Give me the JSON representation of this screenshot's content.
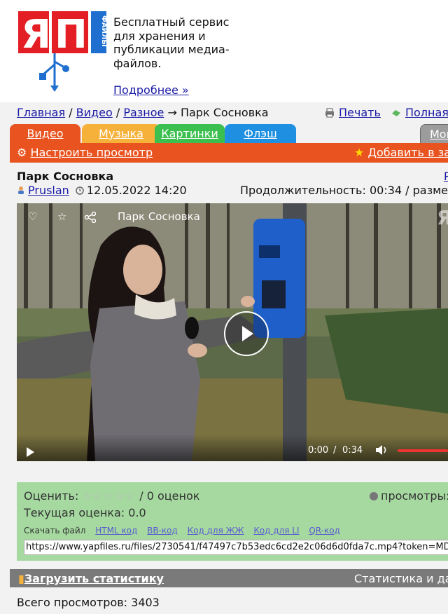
{
  "header": {
    "tagline": "Бесплатный сервис для хранения и публикации медиа-файлов.",
    "more_link": "Подробнее »",
    "logo_text": "ЯП",
    "logo_side_text": "ФАЙЛЫ"
  },
  "breadcrumb": {
    "items": [
      "Главная",
      "Видео",
      "Разное"
    ],
    "current": "Парк Сосновка",
    "print": "Печать",
    "full": "Полная в"
  },
  "tabs": [
    "Видео",
    "Музыка",
    "Картинки",
    "Флэш",
    "Мои"
  ],
  "toolbar": {
    "configure": "Настроить просмотр",
    "add": "Добавить в зак"
  },
  "file": {
    "title": "Парк Сосновка",
    "title_right": "Р",
    "author": "Pruslan",
    "date": "12.05.2022 14:20",
    "duration_line": "Продолжительность: 00:34 / размер: 2"
  },
  "player": {
    "title": "Парк Сосновка",
    "current_time": "0:00",
    "separator": "/",
    "duration": "0:34",
    "watermark": "Я"
  },
  "rating": {
    "label": "Оценить:",
    "stars": "☆☆☆☆☆",
    "count": "/ 0 оценок",
    "views_label": "просмотры:",
    "score": "Текущая оценка: 0.0",
    "download": "Скачать файл",
    "links": [
      "HTML код",
      "BB-код",
      "Код для ЖЖ",
      "Код для LI",
      "QR-код"
    ],
    "url": "https://www.yapfiles.ru/files/2730541/f47497c7b53edc6cd2e2c06d6d0fda7c.mp4?token=MDI3Mz"
  },
  "stats": {
    "upload": "Загрузить статистику",
    "right": "Статистика и дан",
    "total": "Всего просмотров: 3403"
  },
  "colors": {
    "orange": "#e8531f",
    "yellow": "#f6b13b",
    "green": "#3bbf4e",
    "blue": "#1e8fe1",
    "logo_red": "#e31e24",
    "logo_blue": "#1e6fd0"
  }
}
